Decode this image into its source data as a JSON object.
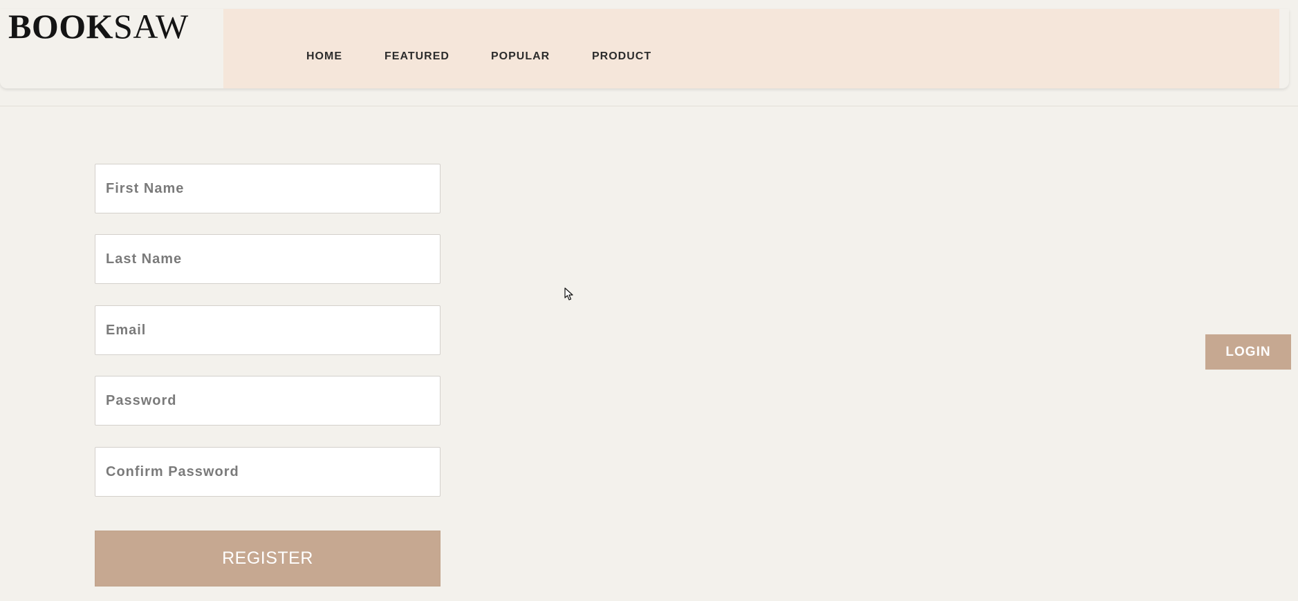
{
  "brand": {
    "bold": "BOOK",
    "light": "SAW"
  },
  "nav": {
    "items": [
      {
        "label": "HOME"
      },
      {
        "label": "FEATURED"
      },
      {
        "label": "POPULAR"
      },
      {
        "label": "PRODUCT"
      }
    ]
  },
  "form": {
    "first_name": {
      "placeholder": "First Name",
      "value": ""
    },
    "last_name": {
      "placeholder": "Last Name",
      "value": ""
    },
    "email": {
      "placeholder": "Email",
      "value": ""
    },
    "password": {
      "placeholder": "Password",
      "value": ""
    },
    "confirm_password": {
      "placeholder": "Confirm Password",
      "value": ""
    },
    "register_label": "REGISTER"
  },
  "login_label": "LOGIN",
  "colors": {
    "background": "#f3f1ec",
    "nav_background": "#f5e6da",
    "accent": "#c6a891",
    "text_dark": "#2c2c2c"
  },
  "icons": {
    "cursor": "mouse-pointer-icon"
  }
}
